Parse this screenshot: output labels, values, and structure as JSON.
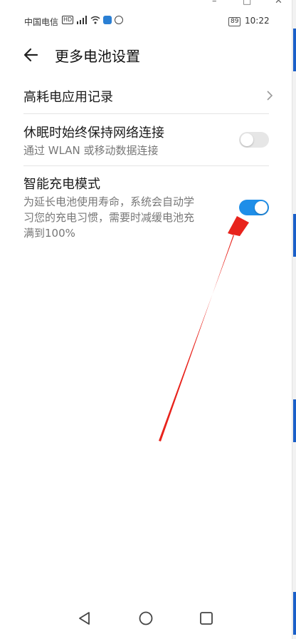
{
  "status_bar": {
    "carrier": "中国电信",
    "hd_badge": "HD",
    "signal_label": "4G",
    "battery": "89",
    "time": "10:22"
  },
  "header": {
    "title": "更多电池设置"
  },
  "settings": [
    {
      "label": "高耗电应用记录"
    },
    {
      "label": "休眠时始终保持网络连接",
      "description": "通过 WLAN 或移动数据连接",
      "enabled": false
    },
    {
      "label": "智能充电模式",
      "description_lines": [
        "为延长电池使用寿命，系统会自动学",
        "习您的充电习惯，需要时减缓电池充",
        "满到100%"
      ],
      "enabled": true
    }
  ],
  "colors": {
    "toggle_on": "#1e8ee8",
    "toggle_off": "#e6e6e6",
    "annotation_arrow": "#e8231c"
  },
  "icons": [
    "back-arrow-icon",
    "chevron-right-icon",
    "wifi-icon",
    "signal-icon",
    "nav-back-icon",
    "nav-home-icon",
    "nav-recents-icon"
  ]
}
